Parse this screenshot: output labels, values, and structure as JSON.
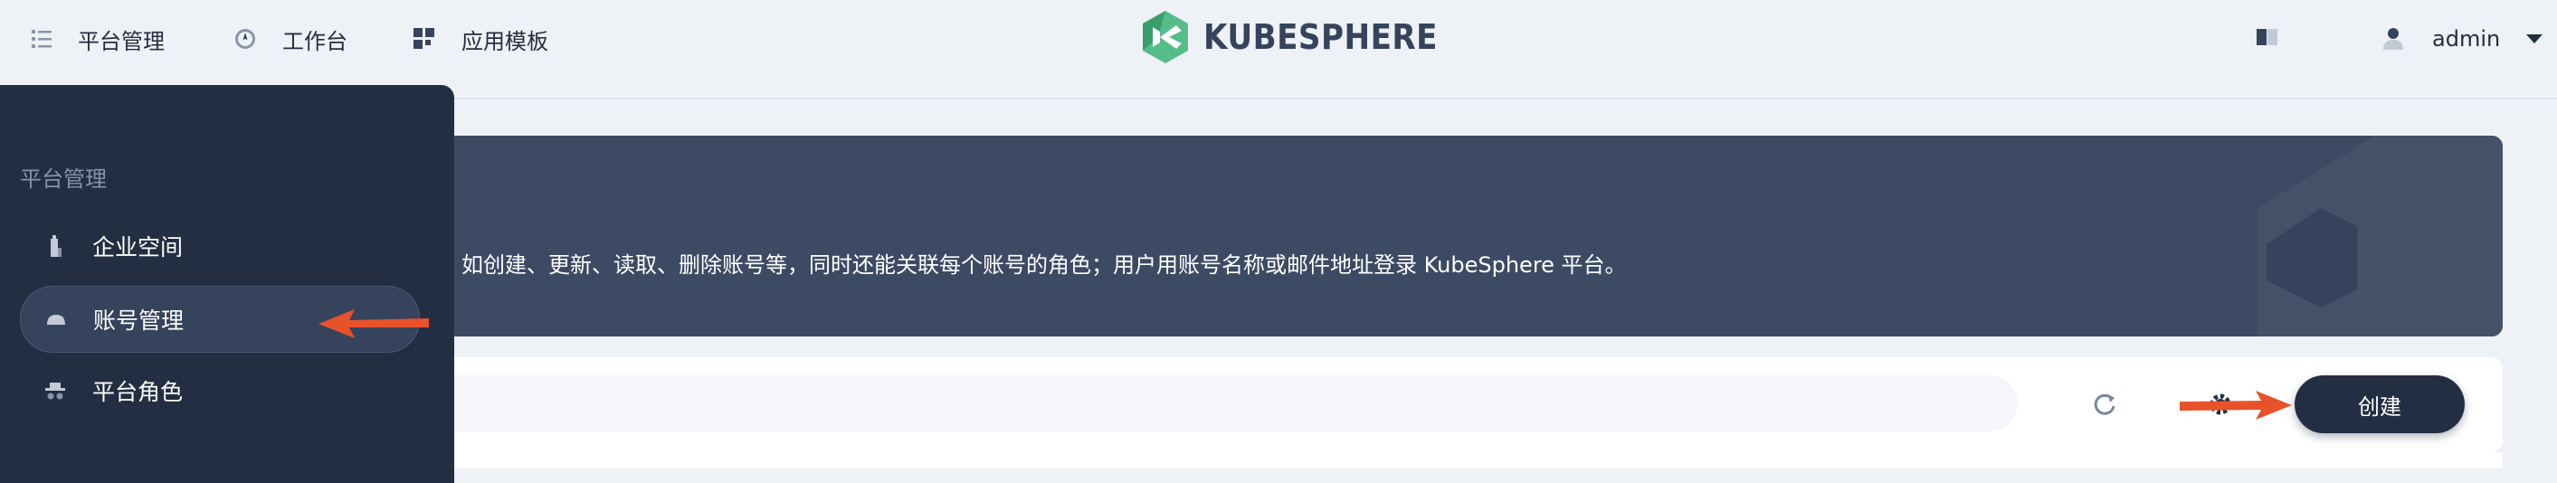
{
  "topbar": {
    "nav": [
      {
        "label": "平台管理",
        "icon": "list-icon"
      },
      {
        "label": "工作台",
        "icon": "compass-icon"
      },
      {
        "label": "应用模板",
        "icon": "grid-icon"
      }
    ],
    "logo_text": "KUBESPHERE",
    "user": "admin"
  },
  "banner": {
    "description": "如创建、更新、读取、删除账号等，同时还能关联每个账号的角色；用户用账号名称或邮件地址登录 KubeSphere 平台。"
  },
  "toolbar": {
    "create_label": "创建"
  },
  "sidemenu": {
    "title": "平台管理",
    "items": [
      {
        "label": "企业空间",
        "icon": "enterprise-icon",
        "active": false
      },
      {
        "label": "账号管理",
        "icon": "account-icon",
        "active": true
      },
      {
        "label": "平台角色",
        "icon": "role-icon",
        "active": false
      }
    ]
  },
  "colors": {
    "brand_green": "#55bc8a",
    "dark": "#242e42",
    "banner": "#3d4a63",
    "annotation_arrow": "#e8522b"
  }
}
